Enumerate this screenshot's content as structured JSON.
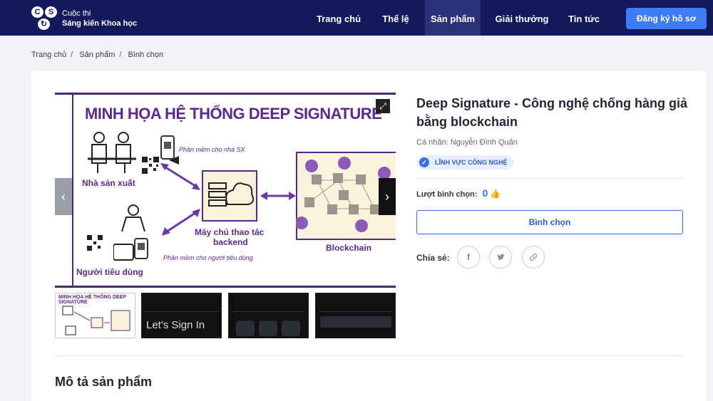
{
  "brand": {
    "line1": "Cuộc thi",
    "line2": "Sáng kiến Khoa học",
    "logo_letters": [
      "C",
      "S",
      "↻"
    ]
  },
  "nav": {
    "items": [
      "Trang chủ",
      "Thể lệ",
      "Sản phẩm",
      "Giải thưởng",
      "Tin tức"
    ],
    "active": "Sản phẩm",
    "register": "Đăng ký hồ sơ"
  },
  "breadcrumb": [
    "Trang chủ",
    "Sản phẩm",
    "Bình chọn"
  ],
  "gallery": {
    "main_title": "MINH HỌA HỆ THỐNG DEEP SIGNATURE",
    "labels": {
      "producer": "Nhà sản xuất",
      "producer_sw": "Phần mềm cho nhà SX",
      "server": "Máy chủ thao tác",
      "server2": "backend",
      "blockchain": "Blockchain",
      "consumer": "Người tiêu dùng",
      "consumer_sw": "Phần mềm cho người tiêu dùng"
    },
    "thumb1_title": "MINH HỌA HỆ THỐNG DEEP SIGNATURE",
    "thumb2_text": "Let's Sign In"
  },
  "product": {
    "title": "Deep Signature - Công nghệ chống hàng giả bằng blockchain",
    "author": "Cá nhân: Nguyễn Đình Quân",
    "field": "LĨNH VỰC CÔNG NGHỆ",
    "votes_label": "Lượt bình chọn:",
    "votes_count": "0",
    "vote_button": "Bình chọn",
    "share_label": "Chia sẻ:"
  },
  "section": {
    "description_title": "Mô tả sản phẩm"
  }
}
